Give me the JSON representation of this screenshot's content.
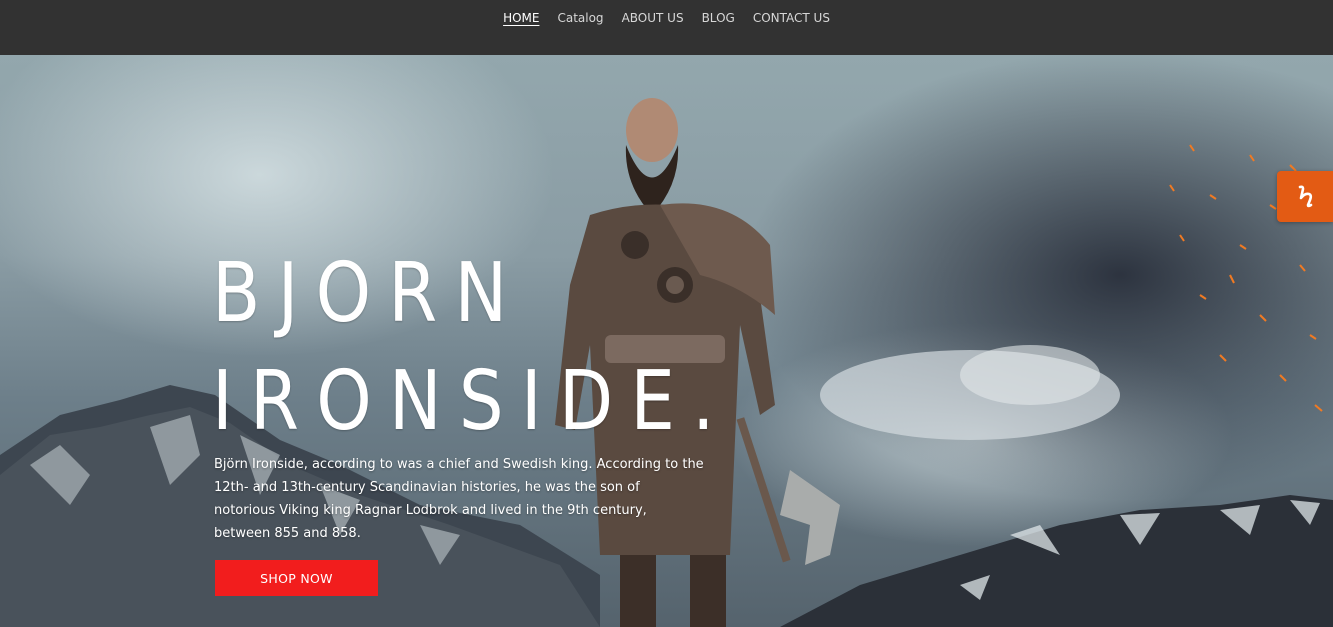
{
  "nav": {
    "items": [
      {
        "label": "HOME",
        "active": true
      },
      {
        "label": "Catalog",
        "active": false
      },
      {
        "label": "ABOUT US",
        "active": false
      },
      {
        "label": "BLOG",
        "active": false
      },
      {
        "label": "CONTACT US",
        "active": false
      }
    ]
  },
  "hero": {
    "title_line1": "BJORN",
    "title_line2": "IRONSIDE.",
    "description": "Björn Ironside, according to was a chief and Swedish king. According to the 12th- and 13th-century Scandinavian histories, he was the son of notorious Viking king Ragnar Lodbrok and lived in the 9th century, between 855 and 858.",
    "cta_label": "SHOP NOW"
  },
  "badge": {
    "icon": "h-logo-icon",
    "letter": "h"
  },
  "colors": {
    "nav_bg": "#323232",
    "cta": "#f21d1d",
    "badge": "#e35b14"
  }
}
